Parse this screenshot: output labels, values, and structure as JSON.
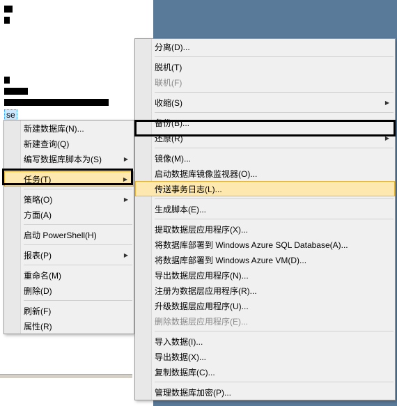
{
  "tree": {
    "selected_db": "se"
  },
  "menu1": {
    "items": [
      {
        "label": "新建数据库(N)...",
        "sub": false
      },
      {
        "label": "新建查询(Q)",
        "sub": false
      },
      {
        "label": "编写数据库脚本为(S)",
        "sub": true
      },
      {
        "sep": true
      },
      {
        "label": "任务(T)",
        "sub": true,
        "hover": true
      },
      {
        "sep": true
      },
      {
        "label": "策略(O)",
        "sub": true
      },
      {
        "label": "方面(A)",
        "sub": false
      },
      {
        "sep": true
      },
      {
        "label": "启动 PowerShell(H)",
        "sub": false
      },
      {
        "sep": true
      },
      {
        "label": "报表(P)",
        "sub": true
      },
      {
        "sep": true
      },
      {
        "label": "重命名(M)",
        "sub": false
      },
      {
        "label": "删除(D)",
        "sub": false
      },
      {
        "sep": true
      },
      {
        "label": "刷新(F)",
        "sub": false
      },
      {
        "label": "属性(R)",
        "sub": false
      }
    ]
  },
  "menu2": {
    "items": [
      {
        "label": "分离(D)...",
        "sub": false
      },
      {
        "sep": true
      },
      {
        "label": "脱机(T)",
        "sub": false
      },
      {
        "label": "联机(F)",
        "sub": false,
        "disabled": true
      },
      {
        "sep": true
      },
      {
        "label": "收缩(S)",
        "sub": true
      },
      {
        "sep": true
      },
      {
        "label": "备份(B)...",
        "sub": false
      },
      {
        "label": "还原(R)",
        "sub": true
      },
      {
        "sep": true
      },
      {
        "label": "镜像(M)...",
        "sub": false
      },
      {
        "label": "启动数据库镜像监视器(O)...",
        "sub": false
      },
      {
        "label": "传送事务日志(L)...",
        "sub": false,
        "hover": true
      },
      {
        "sep": true
      },
      {
        "label": "生成脚本(E)...",
        "sub": false
      },
      {
        "sep": true
      },
      {
        "label": "提取数据层应用程序(X)...",
        "sub": false
      },
      {
        "label": "将数据库部署到 Windows Azure SQL Database(A)...",
        "sub": false
      },
      {
        "label": "将数据库部署到 Windows Azure VM(D)...",
        "sub": false
      },
      {
        "label": "导出数据层应用程序(N)...",
        "sub": false
      },
      {
        "label": "注册为数据层应用程序(R)...",
        "sub": false
      },
      {
        "label": "升级数据层应用程序(U)...",
        "sub": false
      },
      {
        "label": "删除数据层应用程序(E)...",
        "sub": false,
        "disabled": true
      },
      {
        "sep": true
      },
      {
        "label": "导入数据(I)...",
        "sub": false
      },
      {
        "label": "导出数据(X)...",
        "sub": false
      },
      {
        "label": "复制数据库(C)...",
        "sub": false
      },
      {
        "sep": true
      },
      {
        "label": "管理数据库加密(P)...",
        "sub": false
      }
    ]
  }
}
